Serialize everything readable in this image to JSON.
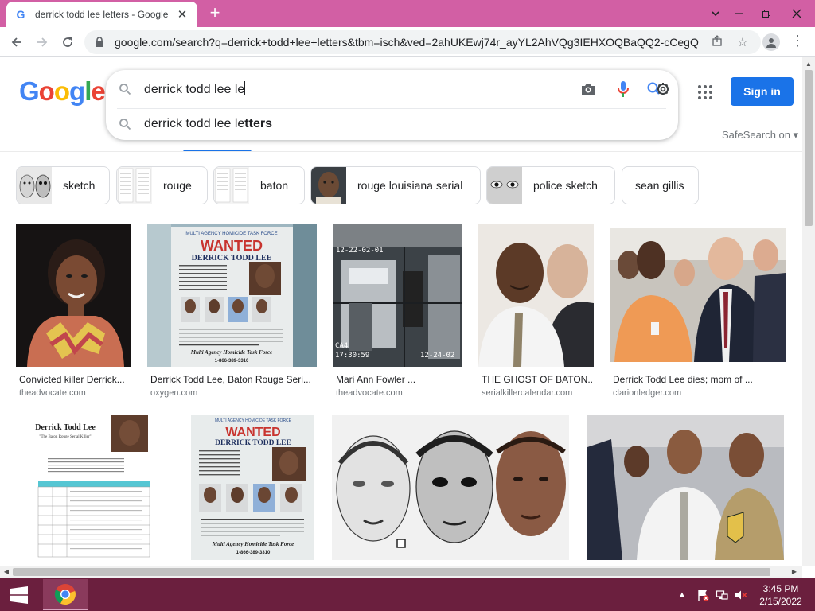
{
  "browser": {
    "tab_title": "derrick todd lee letters - Google",
    "new_tab_symbol": "+",
    "url": "google.com/search?q=derrick+todd+lee+letters&tbm=isch&ved=2ahUKEwj74r_ayYL2AhVQg3IEHXOQBaQQ2-cCegQ..."
  },
  "google": {
    "logo": [
      "G",
      "o",
      "o",
      "g",
      "l",
      "e"
    ],
    "search_query": "derrick todd lee le",
    "suggestion_typed": "derrick todd lee le",
    "suggestion_completion": "tters",
    "sign_in_label": "Sign in",
    "safesearch_label": "SafeSearch on ▾"
  },
  "chips": [
    {
      "label": "sketch"
    },
    {
      "label": "rouge"
    },
    {
      "label": "baton"
    },
    {
      "label": "rouge louisiana serial"
    },
    {
      "label": "police sketch"
    },
    {
      "label": "sean gillis"
    }
  ],
  "results": [
    {
      "caption": "Convicted killer Derrick...",
      "source": "theadvocate.com"
    },
    {
      "caption": "Derrick Todd Lee, Baton Rouge Seri...",
      "source": "oxygen.com"
    },
    {
      "caption": "Mari Ann Fowler ...",
      "source": "theadvocate.com"
    },
    {
      "caption": "THE GHOST OF BATON...",
      "source": "serialkillercalendar.com"
    },
    {
      "caption": "Derrick Todd Lee dies; mom of ...",
      "source": "clarionledger.com"
    }
  ],
  "poster_text": {
    "header": "MULTI AGENCY HOMICIDE TASK FORCE",
    "wanted": "WANTED",
    "name": "DERRICK TODD LEE",
    "footer": "Multi Agency Homicide Task Force",
    "phone": "1-866-389-3310"
  },
  "doc_text": {
    "title": "Derrick Todd Lee",
    "subtitle": "\"The Baton Rouge Serial Killer\""
  },
  "cctv_text": {
    "top": "12-22-02-01",
    "bottom_left": "CA4",
    "time": "17:30:59",
    "date": "12-24-02"
  },
  "taskbar": {
    "time": "3:45 PM",
    "date": "2/15/2022"
  },
  "colors": {
    "tabstrip": "#d25fa4",
    "taskbar": "#6b1f3e",
    "accent_blue": "#1a73e8"
  }
}
